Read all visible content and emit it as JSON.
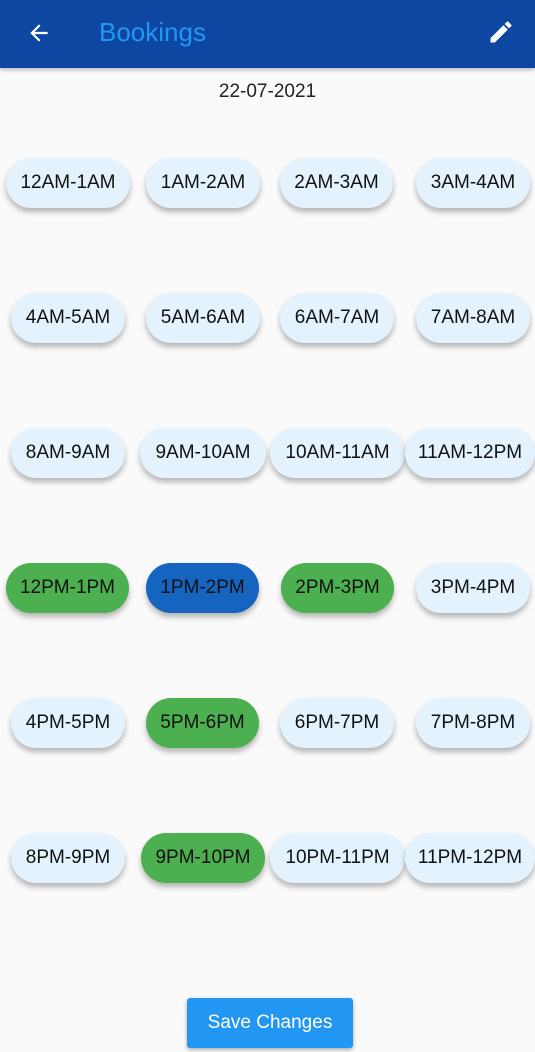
{
  "appbar": {
    "title": "Bookings",
    "back_icon": "arrow-left-icon",
    "edit_icon": "pencil-icon"
  },
  "date": "22-07-2021",
  "colors": {
    "appbar_bg": "#0d47a1",
    "title": "#2196f3",
    "slot_default": "#e3f2fd",
    "slot_booked": "#4caf50",
    "slot_selected": "#1565c0",
    "save_button": "#2196f3"
  },
  "slots": [
    {
      "label": "12AM-1AM",
      "state": "available"
    },
    {
      "label": "1AM-2AM",
      "state": "available"
    },
    {
      "label": "2AM-3AM",
      "state": "available"
    },
    {
      "label": "3AM-4AM",
      "state": "available"
    },
    {
      "label": "4AM-5AM",
      "state": "available"
    },
    {
      "label": "5AM-6AM",
      "state": "available"
    },
    {
      "label": "6AM-7AM",
      "state": "available"
    },
    {
      "label": "7AM-8AM",
      "state": "available"
    },
    {
      "label": "8AM-9AM",
      "state": "available"
    },
    {
      "label": "9AM-10AM",
      "state": "available"
    },
    {
      "label": "10AM-11AM",
      "state": "available"
    },
    {
      "label": "11AM-12PM",
      "state": "available"
    },
    {
      "label": "12PM-1PM",
      "state": "booked"
    },
    {
      "label": "1PM-2PM",
      "state": "selected"
    },
    {
      "label": "2PM-3PM",
      "state": "booked"
    },
    {
      "label": "3PM-4PM",
      "state": "available"
    },
    {
      "label": "4PM-5PM",
      "state": "available"
    },
    {
      "label": "5PM-6PM",
      "state": "booked"
    },
    {
      "label": "6PM-7PM",
      "state": "available"
    },
    {
      "label": "7PM-8PM",
      "state": "available"
    },
    {
      "label": "8PM-9PM",
      "state": "available"
    },
    {
      "label": "9PM-10PM",
      "state": "booked"
    },
    {
      "label": "10PM-11PM",
      "state": "available"
    },
    {
      "label": "11PM-12PM",
      "state": "available"
    }
  ],
  "save_button": {
    "label": "Save Changes"
  }
}
